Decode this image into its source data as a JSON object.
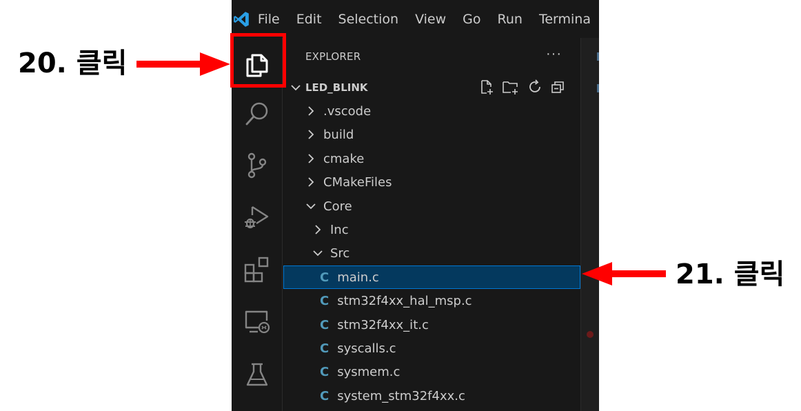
{
  "annotations": {
    "step20": "20. 클릭",
    "step21": "21. 클릭",
    "color": "#ff0000"
  },
  "menubar": {
    "logo_icon": "vscode-logo-icon",
    "items": [
      "File",
      "Edit",
      "Selection",
      "View",
      "Go",
      "Run",
      "Termina"
    ]
  },
  "activitybar": {
    "items": [
      {
        "name": "explorer",
        "icon": "files-icon"
      },
      {
        "name": "search",
        "icon": "search-icon"
      },
      {
        "name": "source-control",
        "icon": "source-control-icon"
      },
      {
        "name": "run-debug",
        "icon": "run-debug-icon"
      },
      {
        "name": "extensions",
        "icon": "extensions-icon"
      },
      {
        "name": "remote-explorer",
        "icon": "remote-explorer-icon"
      },
      {
        "name": "testing",
        "icon": "flask-icon"
      }
    ]
  },
  "explorer": {
    "header": "EXPLORER",
    "more": "···",
    "project": "LED_BLINK",
    "tree": [
      {
        "label": ".vscode",
        "type": "folder",
        "expanded": false,
        "depth": 0
      },
      {
        "label": "build",
        "type": "folder",
        "expanded": false,
        "depth": 0
      },
      {
        "label": "cmake",
        "type": "folder",
        "expanded": false,
        "depth": 0
      },
      {
        "label": "CMakeFiles",
        "type": "folder",
        "expanded": false,
        "depth": 0
      },
      {
        "label": "Core",
        "type": "folder",
        "expanded": true,
        "depth": 0
      },
      {
        "label": "Inc",
        "type": "folder",
        "expanded": false,
        "depth": 1
      },
      {
        "label": "Src",
        "type": "folder",
        "expanded": true,
        "depth": 1
      },
      {
        "label": "main.c",
        "type": "file",
        "selected": true,
        "depth": 2
      },
      {
        "label": "stm32f4xx_hal_msp.c",
        "type": "file",
        "depth": 2
      },
      {
        "label": "stm32f4xx_it.c",
        "type": "file",
        "depth": 2
      },
      {
        "label": "syscalls.c",
        "type": "file",
        "depth": 2
      },
      {
        "label": "sysmem.c",
        "type": "file",
        "depth": 2
      },
      {
        "label": "system_stm32f4xx.c",
        "type": "file",
        "depth": 2
      }
    ],
    "file_badge": "C"
  }
}
